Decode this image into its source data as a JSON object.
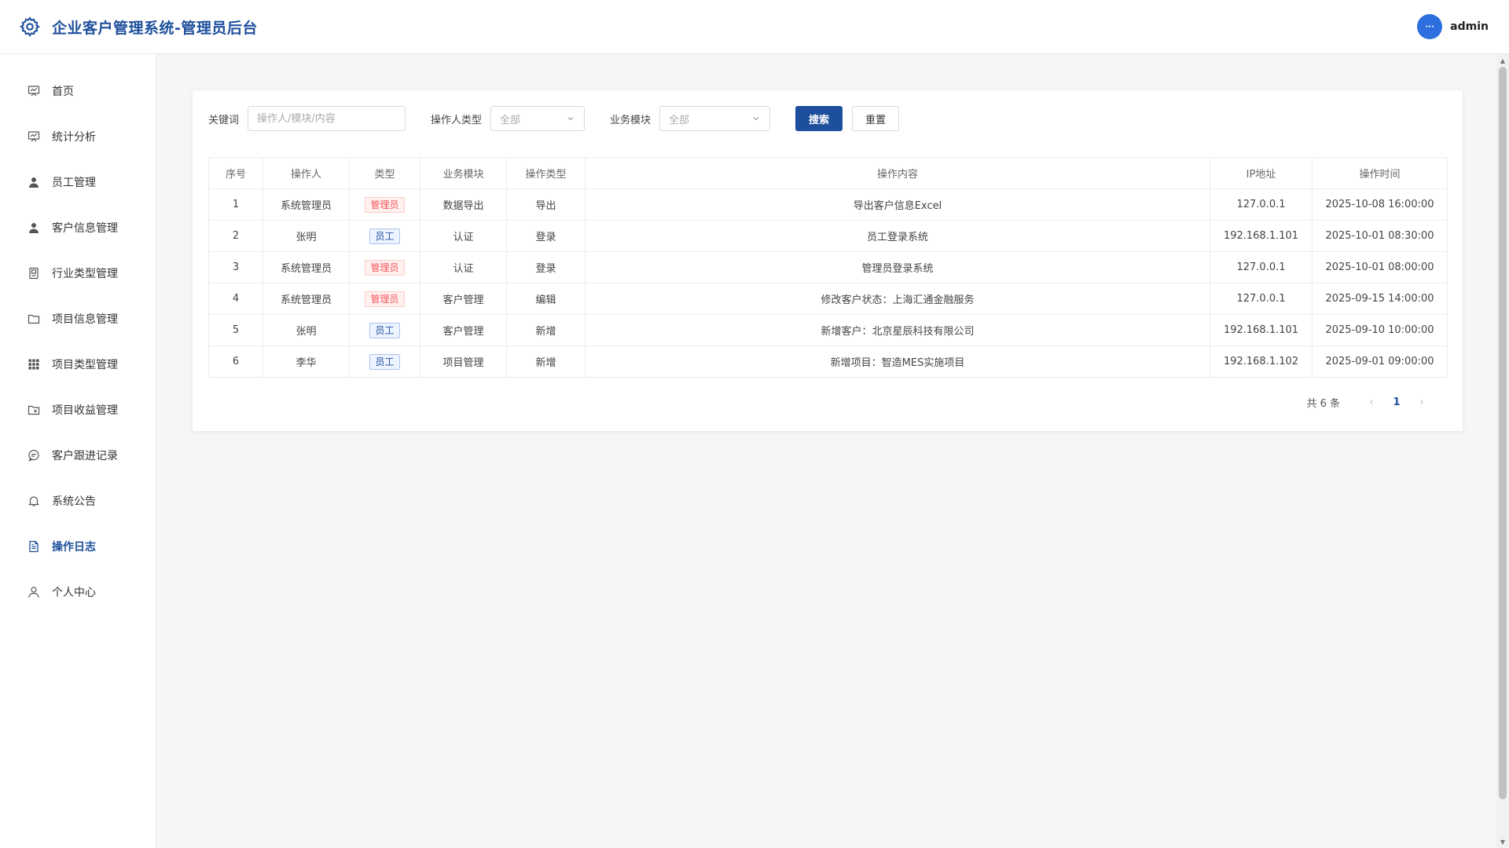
{
  "header": {
    "title": "企业客户管理系统-管理员后台",
    "avatar_text": "···",
    "username": "admin"
  },
  "colors": {
    "brand": "#1e4f9c",
    "avatar": "#2e6fe0",
    "tag_admin": "#f5555a",
    "tag_staff": "#1e4f9c"
  },
  "sidebar": {
    "items": [
      {
        "label": "首页",
        "icon": "chart-board-icon"
      },
      {
        "label": "统计分析",
        "icon": "chart-board-icon"
      },
      {
        "label": "员工管理",
        "icon": "user-solid-icon"
      },
      {
        "label": "客户信息管理",
        "icon": "user-solid-icon"
      },
      {
        "label": "行业类型管理",
        "icon": "document-box-icon"
      },
      {
        "label": "项目信息管理",
        "icon": "folder-icon"
      },
      {
        "label": "项目类型管理",
        "icon": "grid-icon"
      },
      {
        "label": "项目收益管理",
        "icon": "folder-add-icon"
      },
      {
        "label": "客户跟进记录",
        "icon": "chat-bubble-icon"
      },
      {
        "label": "系统公告",
        "icon": "bell-icon"
      },
      {
        "label": "操作日志",
        "icon": "document-icon",
        "active": true
      },
      {
        "label": "个人中心",
        "icon": "user-outline-icon"
      }
    ]
  },
  "filters": {
    "keyword_label": "关键词",
    "keyword_placeholder": "操作人/模块/内容",
    "operator_type_label": "操作人类型",
    "operator_type_value": "全部",
    "module_label": "业务模块",
    "module_value": "全部",
    "search_label": "搜索",
    "reset_label": "重置"
  },
  "table": {
    "headers": [
      "序号",
      "操作人",
      "类型",
      "业务模块",
      "操作类型",
      "操作内容",
      "IP地址",
      "操作时间"
    ],
    "rows": [
      {
        "no": "1",
        "operator": "系统管理员",
        "type": "管理员",
        "type_kind": "admin",
        "module": "数据导出",
        "action": "导出",
        "content": "导出客户信息Excel",
        "ip": "127.0.0.1",
        "time": "2025-10-08 16:00:00"
      },
      {
        "no": "2",
        "operator": "张明",
        "type": "员工",
        "type_kind": "staff",
        "module": "认证",
        "action": "登录",
        "content": "员工登录系统",
        "ip": "192.168.1.101",
        "time": "2025-10-01 08:30:00"
      },
      {
        "no": "3",
        "operator": "系统管理员",
        "type": "管理员",
        "type_kind": "admin",
        "module": "认证",
        "action": "登录",
        "content": "管理员登录系统",
        "ip": "127.0.0.1",
        "time": "2025-10-01 08:00:00"
      },
      {
        "no": "4",
        "operator": "系统管理员",
        "type": "管理员",
        "type_kind": "admin",
        "module": "客户管理",
        "action": "编辑",
        "content": "修改客户状态：上海汇通金融服务",
        "ip": "127.0.0.1",
        "time": "2025-09-15 14:00:00"
      },
      {
        "no": "5",
        "operator": "张明",
        "type": "员工",
        "type_kind": "staff",
        "module": "客户管理",
        "action": "新增",
        "content": "新增客户：北京星辰科技有限公司",
        "ip": "192.168.1.101",
        "time": "2025-09-10 10:00:00"
      },
      {
        "no": "6",
        "operator": "李华",
        "type": "员工",
        "type_kind": "staff",
        "module": "项目管理",
        "action": "新增",
        "content": "新增项目：智造MES实施项目",
        "ip": "192.168.1.102",
        "time": "2025-09-01 09:00:00"
      }
    ]
  },
  "pagination": {
    "total": "共 6 条",
    "current": "1"
  }
}
